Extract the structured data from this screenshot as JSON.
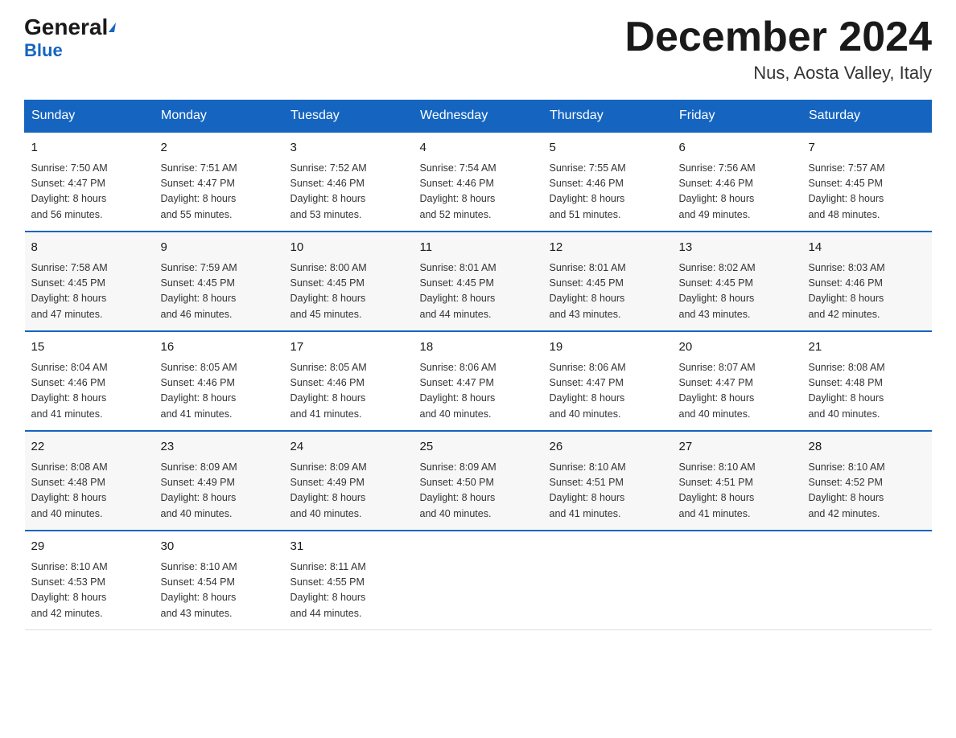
{
  "header": {
    "logo_general": "General",
    "logo_triangle": "▶",
    "logo_blue": "Blue",
    "month_title": "December 2024",
    "location": "Nus, Aosta Valley, Italy"
  },
  "days_of_week": [
    "Sunday",
    "Monday",
    "Tuesday",
    "Wednesday",
    "Thursday",
    "Friday",
    "Saturday"
  ],
  "weeks": [
    [
      {
        "day": "1",
        "sunrise": "7:50 AM",
        "sunset": "4:47 PM",
        "daylight": "8 hours and 56 minutes."
      },
      {
        "day": "2",
        "sunrise": "7:51 AM",
        "sunset": "4:47 PM",
        "daylight": "8 hours and 55 minutes."
      },
      {
        "day": "3",
        "sunrise": "7:52 AM",
        "sunset": "4:46 PM",
        "daylight": "8 hours and 53 minutes."
      },
      {
        "day": "4",
        "sunrise": "7:54 AM",
        "sunset": "4:46 PM",
        "daylight": "8 hours and 52 minutes."
      },
      {
        "day": "5",
        "sunrise": "7:55 AM",
        "sunset": "4:46 PM",
        "daylight": "8 hours and 51 minutes."
      },
      {
        "day": "6",
        "sunrise": "7:56 AM",
        "sunset": "4:46 PM",
        "daylight": "8 hours and 49 minutes."
      },
      {
        "day": "7",
        "sunrise": "7:57 AM",
        "sunset": "4:45 PM",
        "daylight": "8 hours and 48 minutes."
      }
    ],
    [
      {
        "day": "8",
        "sunrise": "7:58 AM",
        "sunset": "4:45 PM",
        "daylight": "8 hours and 47 minutes."
      },
      {
        "day": "9",
        "sunrise": "7:59 AM",
        "sunset": "4:45 PM",
        "daylight": "8 hours and 46 minutes."
      },
      {
        "day": "10",
        "sunrise": "8:00 AM",
        "sunset": "4:45 PM",
        "daylight": "8 hours and 45 minutes."
      },
      {
        "day": "11",
        "sunrise": "8:01 AM",
        "sunset": "4:45 PM",
        "daylight": "8 hours and 44 minutes."
      },
      {
        "day": "12",
        "sunrise": "8:01 AM",
        "sunset": "4:45 PM",
        "daylight": "8 hours and 43 minutes."
      },
      {
        "day": "13",
        "sunrise": "8:02 AM",
        "sunset": "4:45 PM",
        "daylight": "8 hours and 43 minutes."
      },
      {
        "day": "14",
        "sunrise": "8:03 AM",
        "sunset": "4:46 PM",
        "daylight": "8 hours and 42 minutes."
      }
    ],
    [
      {
        "day": "15",
        "sunrise": "8:04 AM",
        "sunset": "4:46 PM",
        "daylight": "8 hours and 41 minutes."
      },
      {
        "day": "16",
        "sunrise": "8:05 AM",
        "sunset": "4:46 PM",
        "daylight": "8 hours and 41 minutes."
      },
      {
        "day": "17",
        "sunrise": "8:05 AM",
        "sunset": "4:46 PM",
        "daylight": "8 hours and 41 minutes."
      },
      {
        "day": "18",
        "sunrise": "8:06 AM",
        "sunset": "4:47 PM",
        "daylight": "8 hours and 40 minutes."
      },
      {
        "day": "19",
        "sunrise": "8:06 AM",
        "sunset": "4:47 PM",
        "daylight": "8 hours and 40 minutes."
      },
      {
        "day": "20",
        "sunrise": "8:07 AM",
        "sunset": "4:47 PM",
        "daylight": "8 hours and 40 minutes."
      },
      {
        "day": "21",
        "sunrise": "8:08 AM",
        "sunset": "4:48 PM",
        "daylight": "8 hours and 40 minutes."
      }
    ],
    [
      {
        "day": "22",
        "sunrise": "8:08 AM",
        "sunset": "4:48 PM",
        "daylight": "8 hours and 40 minutes."
      },
      {
        "day": "23",
        "sunrise": "8:09 AM",
        "sunset": "4:49 PM",
        "daylight": "8 hours and 40 minutes."
      },
      {
        "day": "24",
        "sunrise": "8:09 AM",
        "sunset": "4:49 PM",
        "daylight": "8 hours and 40 minutes."
      },
      {
        "day": "25",
        "sunrise": "8:09 AM",
        "sunset": "4:50 PM",
        "daylight": "8 hours and 40 minutes."
      },
      {
        "day": "26",
        "sunrise": "8:10 AM",
        "sunset": "4:51 PM",
        "daylight": "8 hours and 41 minutes."
      },
      {
        "day": "27",
        "sunrise": "8:10 AM",
        "sunset": "4:51 PM",
        "daylight": "8 hours and 41 minutes."
      },
      {
        "day": "28",
        "sunrise": "8:10 AM",
        "sunset": "4:52 PM",
        "daylight": "8 hours and 42 minutes."
      }
    ],
    [
      {
        "day": "29",
        "sunrise": "8:10 AM",
        "sunset": "4:53 PM",
        "daylight": "8 hours and 42 minutes."
      },
      {
        "day": "30",
        "sunrise": "8:10 AM",
        "sunset": "4:54 PM",
        "daylight": "8 hours and 43 minutes."
      },
      {
        "day": "31",
        "sunrise": "8:11 AM",
        "sunset": "4:55 PM",
        "daylight": "8 hours and 44 minutes."
      },
      null,
      null,
      null,
      null
    ]
  ],
  "labels": {
    "sunrise": "Sunrise:",
    "sunset": "Sunset:",
    "daylight": "Daylight:"
  }
}
